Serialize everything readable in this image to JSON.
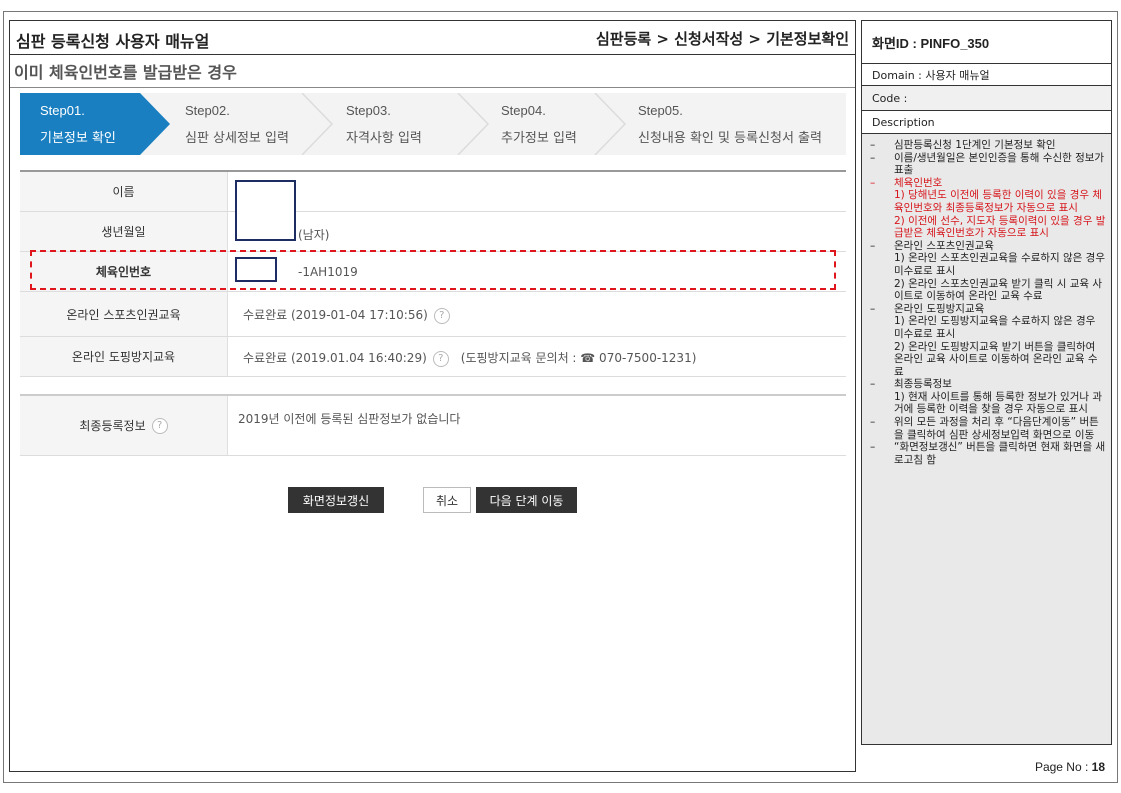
{
  "header": {
    "title": "심판 등록신청 사용자 매뉴얼",
    "breadcrumb": "심판등록 > 신청서작성 > 기본정보확인"
  },
  "subtitle": "이미 체육인번호를 발급받은 경우",
  "steps": [
    {
      "num": "Step01.",
      "label": "기본정보 확인",
      "active": true
    },
    {
      "num": "Step02.",
      "label": "심판 상세정보 입력",
      "active": false
    },
    {
      "num": "Step03.",
      "label": "자격사항 입력",
      "active": false
    },
    {
      "num": "Step04.",
      "label": "추가정보 입력",
      "active": false
    },
    {
      "num": "Step05.",
      "label": "신청내용 확인 및 등록신청서 출력",
      "active": false
    }
  ],
  "form": {
    "name_label": "이름",
    "birth_label": "생년월일",
    "birth_suffix": "(남자)",
    "athlete_no_label": "체육인번호",
    "athlete_no_value": "-1AH1019",
    "sports_edu_label": "온라인 스포츠인권교육",
    "sports_edu_value": "수료완료 (2019-01-04 17:10:56)",
    "doping_edu_label": "온라인 도핑방지교육",
    "doping_edu_value": "수료완료 (2019.01.04 16:40:29)",
    "doping_contact": "(도핑방지교육 문의처 : ☎ 070-7500-1231)",
    "final_reg_label": "최종등록정보",
    "final_reg_value": "2019년 이전에 등록된 심판정보가 없습니다",
    "help_glyph": "?"
  },
  "buttons": {
    "refresh": "화면정보갱신",
    "cancel": "취소",
    "next": "다음 단계 이동"
  },
  "side": {
    "screen_id": "화면ID : PINFO_350",
    "domain": "Domain : 사용자 매뉴얼",
    "code": "Code :",
    "description_label": "Description",
    "items": [
      {
        "text": "심판등록신청 1단계인 기본정보 확인",
        "red": false
      },
      {
        "text": "이름/생년월일은 본인인증을 통해 수신한 정보가 표출",
        "red": false
      },
      {
        "text": "체육인번호\n1) 당해년도 이전에 등록한 이력이 있을 경우 체육인번호와 최종등록정보가 자동으로 표시\n2) 이전에 선수, 지도자 등록이력이 있을 경우 발급받은 체육인번호가 자동으로 표시",
        "red": true
      },
      {
        "text": "온라인 스포츠인권교육\n1) 온라인 스포츠인권교육을 수료하지 않은 경우 미수료로 표시\n2) 온라인 스포츠인권교육 받기 클릭 시 교육 사이트로 이동하여 온라인 교육 수료",
        "red": false
      },
      {
        "text": "온라인 도핑방지교육\n1) 온라인 도핑방지교육을 수료하지 않은 경우 미수료로 표시\n2) 온라인 도핑방지교육 받기 버튼을 클릭하여 온라인 교육 사이트로 이동하여 온라인 교육 수료",
        "red": false
      },
      {
        "text": "최종등록정보\n1) 현재 사이트를 통해 등록한 정보가 있거나 과거에 등록한 이력을 찾을 경우 자동으로 표시",
        "red": false
      },
      {
        "text": "위의 모든 과정을 처리 후 “다음단계이동” 버튼을 클릭하여 심판 상세정보입력 화면으로 이동",
        "red": false
      },
      {
        "text": "“화면정보갱신” 버튼을 클릭하면 현재 화면을 새로고침 함",
        "red": false
      }
    ]
  },
  "page": {
    "label": "Page No : ",
    "number": "18"
  },
  "colors": {
    "active_step": "#1a7fc1",
    "highlight_red": "#e0161d",
    "mask_border": "#1d2c63",
    "button_dark": "#333333"
  }
}
